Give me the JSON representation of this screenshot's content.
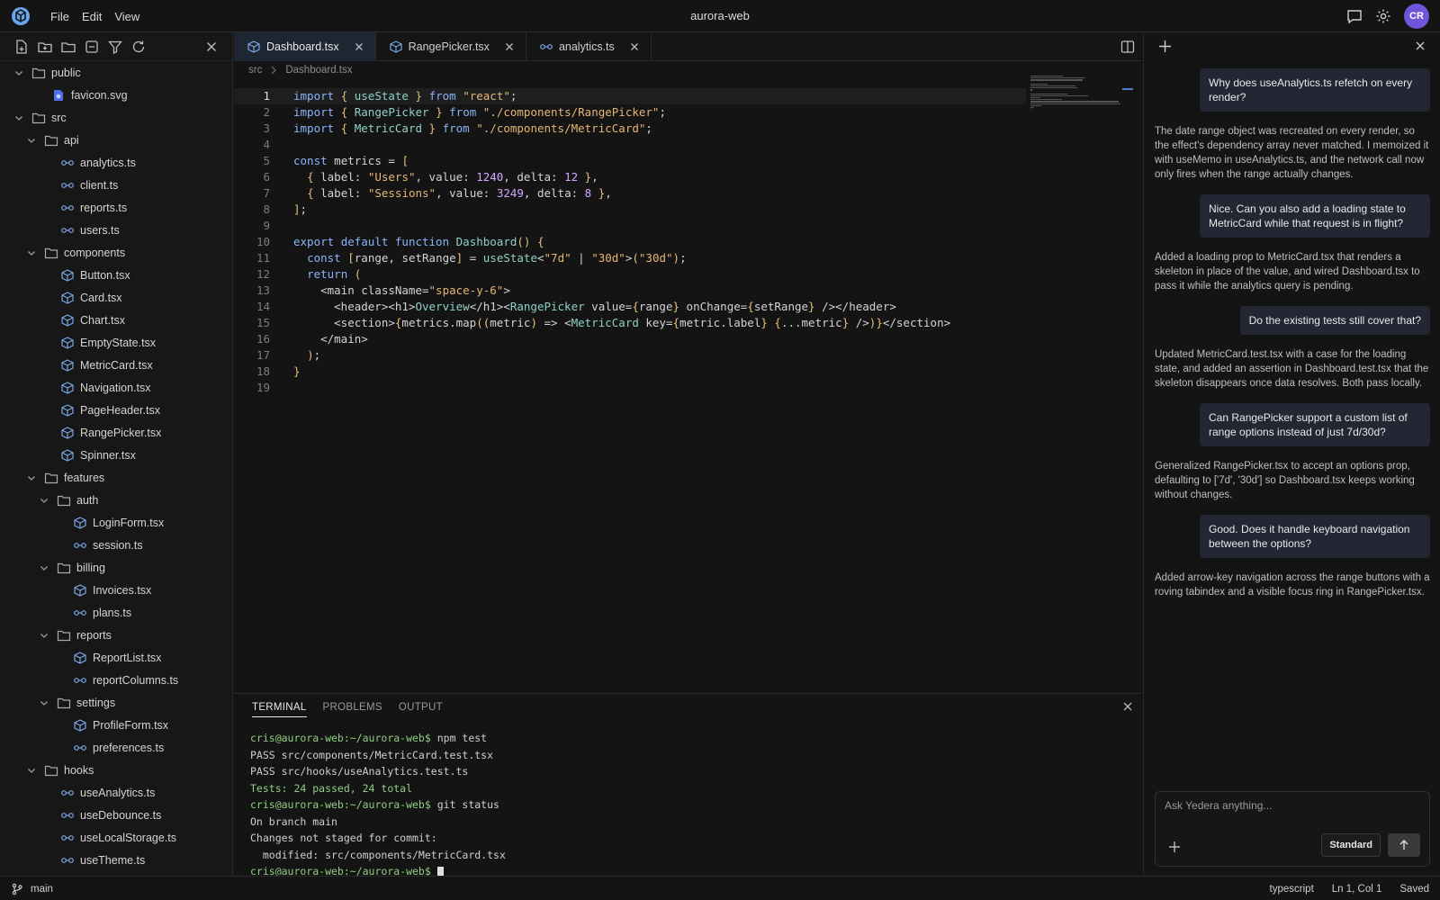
{
  "app": {
    "title": "aurora-web",
    "menu": [
      "File",
      "Edit",
      "View"
    ],
    "avatar_initials": "CR",
    "accent": "#6f55d9"
  },
  "explorer": {
    "items": [
      {
        "label": "public",
        "kind": "folder",
        "depth": 0,
        "expanded": true
      },
      {
        "label": "favicon.svg",
        "kind": "favicon",
        "depth": 1
      },
      {
        "label": "src",
        "kind": "folder",
        "depth": 0,
        "expanded": true
      },
      {
        "label": "api",
        "kind": "folder",
        "depth": 1,
        "expanded": true
      },
      {
        "label": "analytics.ts",
        "kind": "util",
        "depth": 2
      },
      {
        "label": "client.ts",
        "kind": "util",
        "depth": 2
      },
      {
        "label": "reports.ts",
        "kind": "util",
        "depth": 2
      },
      {
        "label": "users.ts",
        "kind": "util",
        "depth": 2
      },
      {
        "label": "components",
        "kind": "folder",
        "depth": 1,
        "expanded": true
      },
      {
        "label": "Button.tsx",
        "kind": "component",
        "depth": 2
      },
      {
        "label": "Card.tsx",
        "kind": "component",
        "depth": 2
      },
      {
        "label": "Chart.tsx",
        "kind": "component",
        "depth": 2
      },
      {
        "label": "EmptyState.tsx",
        "kind": "component",
        "depth": 2
      },
      {
        "label": "MetricCard.tsx",
        "kind": "component",
        "depth": 2
      },
      {
        "label": "Navigation.tsx",
        "kind": "component",
        "depth": 2
      },
      {
        "label": "PageHeader.tsx",
        "kind": "component",
        "depth": 2
      },
      {
        "label": "RangePicker.tsx",
        "kind": "component",
        "depth": 2
      },
      {
        "label": "Spinner.tsx",
        "kind": "component",
        "depth": 2
      },
      {
        "label": "features",
        "kind": "folder",
        "depth": 1,
        "expanded": true
      },
      {
        "label": "auth",
        "kind": "folder",
        "depth": 2,
        "expanded": true
      },
      {
        "label": "LoginForm.tsx",
        "kind": "component",
        "depth": 3
      },
      {
        "label": "session.ts",
        "kind": "util",
        "depth": 3
      },
      {
        "label": "billing",
        "kind": "folder",
        "depth": 2,
        "expanded": true
      },
      {
        "label": "Invoices.tsx",
        "kind": "component",
        "depth": 3
      },
      {
        "label": "plans.ts",
        "kind": "util",
        "depth": 3
      },
      {
        "label": "reports",
        "kind": "folder",
        "depth": 2,
        "expanded": true
      },
      {
        "label": "ReportList.tsx",
        "kind": "component",
        "depth": 3
      },
      {
        "label": "reportColumns.ts",
        "kind": "util",
        "depth": 3
      },
      {
        "label": "settings",
        "kind": "folder",
        "depth": 2,
        "expanded": true
      },
      {
        "label": "ProfileForm.tsx",
        "kind": "component",
        "depth": 3
      },
      {
        "label": "preferences.ts",
        "kind": "util",
        "depth": 3
      },
      {
        "label": "hooks",
        "kind": "folder",
        "depth": 1,
        "expanded": true
      },
      {
        "label": "useAnalytics.ts",
        "kind": "util",
        "depth": 2
      },
      {
        "label": "useDebounce.ts",
        "kind": "util",
        "depth": 2
      },
      {
        "label": "useLocalStorage.ts",
        "kind": "util",
        "depth": 2
      },
      {
        "label": "useTheme.ts",
        "kind": "util",
        "depth": 2
      }
    ]
  },
  "tabs": [
    {
      "label": "Dashboard.tsx",
      "active": true,
      "icon": "component-icon"
    },
    {
      "label": "RangePicker.tsx",
      "active": false,
      "icon": "component-icon"
    },
    {
      "label": "analytics.ts",
      "active": false,
      "icon": "util-icon"
    }
  ],
  "breadcrumb": [
    "src",
    "Dashboard.tsx"
  ],
  "code": {
    "active_line": 1,
    "lines": [
      "import { useState } from \"react\";",
      "import { RangePicker } from \"./components/RangePicker\";",
      "import { MetricCard } from \"./components/MetricCard\";",
      "",
      "const metrics = [",
      "  { label: \"Users\", value: 1240, delta: 12 },",
      "  { label: \"Sessions\", value: 3249, delta: 8 },",
      "];",
      "",
      "export default function Dashboard() {",
      "  const [range, setRange] = useState<\"7d\" | \"30d\">(\"30d\");",
      "  return (",
      "    <main className=\"space-y-6\">",
      "      <header><h1>Overview</h1><RangePicker value={range} onChange={setRange} /></header>",
      "      <section>{metrics.map((metric) => <MetricCard key={metric.label} {...metric} />)}</section>",
      "    </main>",
      "  );",
      "}",
      ""
    ]
  },
  "panel": {
    "tabs": [
      "TERMINAL",
      "PROBLEMS",
      "OUTPUT"
    ],
    "active_tab": "TERMINAL",
    "terminal_lines": [
      {
        "prompt": "cris@aurora-web:~/aurora-web$",
        "text": " npm test"
      },
      {
        "prompt": "",
        "text": "PASS src/components/MetricCard.test.tsx"
      },
      {
        "prompt": "",
        "text": "PASS src/hooks/useAnalytics.test.ts"
      },
      {
        "prompt": "",
        "text": "Tests: 24 passed, 24 total",
        "green": true
      },
      {
        "prompt": "cris@aurora-web:~/aurora-web$",
        "text": " git status"
      },
      {
        "prompt": "",
        "text": "On branch main"
      },
      {
        "prompt": "",
        "text": "Changes not staged for commit:"
      },
      {
        "prompt": "",
        "text": "  modified: src/components/MetricCard.tsx"
      },
      {
        "prompt": "cris@aurora-web:~/aurora-web$",
        "text": " ",
        "cursor": true
      }
    ]
  },
  "chat": {
    "messages": [
      {
        "role": "user",
        "text": "Why does useAnalytics.ts refetch on every render?"
      },
      {
        "role": "assistant",
        "text": "The date range object was recreated on every render, so the effect's dependency array never matched. I memoized it with useMemo in useAnalytics.ts, and the network call now only fires when the range actually changes."
      },
      {
        "role": "user",
        "text": "Nice. Can you also add a loading state to MetricCard while that request is in flight?"
      },
      {
        "role": "assistant",
        "text": "Added a loading prop to MetricCard.tsx that renders a skeleton in place of the value, and wired Dashboard.tsx to pass it while the analytics query is pending."
      },
      {
        "role": "user",
        "text": "Do the existing tests still cover that?"
      },
      {
        "role": "assistant",
        "text": "Updated MetricCard.test.tsx with a case for the loading state, and added an assertion in Dashboard.test.tsx that the skeleton disappears once data resolves. Both pass locally."
      },
      {
        "role": "user",
        "text": "Can RangePicker support a custom list of range options instead of just 7d/30d?"
      },
      {
        "role": "assistant",
        "text": "Generalized RangePicker.tsx to accept an options prop, defaulting to ['7d', '30d'] so Dashboard.tsx keeps working without changes."
      },
      {
        "role": "user",
        "text": "Good. Does it handle keyboard navigation between the options?"
      },
      {
        "role": "assistant",
        "text": "Added arrow-key navigation across the range buttons with a roving tabindex and a visible focus ring in RangePicker.tsx."
      }
    ],
    "input_placeholder": "Ask Yedera anything...",
    "input_value": "",
    "mode_label": "Standard"
  },
  "status": {
    "branch": "main",
    "language": "typescript",
    "position": "Ln 1, Col 1",
    "save_state": "Saved"
  }
}
